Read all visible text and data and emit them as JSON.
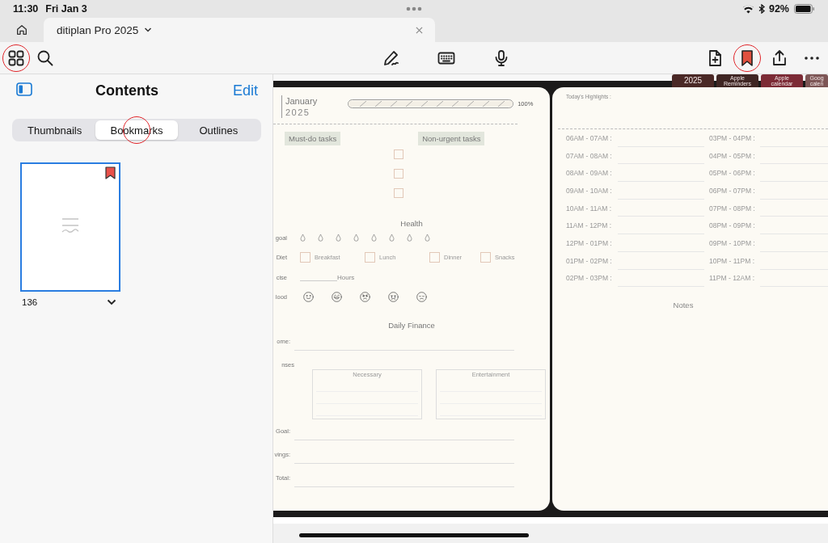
{
  "status_bar": {
    "time": "11:30",
    "date": "Fri Jan 3",
    "battery": "92%"
  },
  "tab_bar": {
    "tab": {
      "title": "ditiplan Pro 2025"
    }
  },
  "toolbar": {
    "left": [
      {
        "kind": "grid",
        "circled": true
      },
      {
        "kind": "search",
        "circled": false
      }
    ],
    "center": [
      {
        "kind": "pen",
        "circled": false
      },
      {
        "kind": "keyboard",
        "circled": false
      },
      {
        "kind": "mic",
        "circled": false
      }
    ],
    "right": [
      {
        "kind": "add-page",
        "circled": false
      },
      {
        "kind": "bookmark",
        "circled": true
      },
      {
        "kind": "share",
        "circled": false
      },
      {
        "kind": "more",
        "circled": false
      }
    ]
  },
  "sidebar": {
    "title": "Contents",
    "edit": "Edit",
    "segments": [
      {
        "label": "Thumbnails",
        "selected": false,
        "circled": false
      },
      {
        "label": "Bookmarks",
        "selected": true,
        "circled": true
      },
      {
        "label": "Outlines",
        "selected": false,
        "circled": false
      }
    ],
    "bookmarks": [
      {
        "page": "136",
        "selected": true
      }
    ]
  },
  "planner": {
    "section_tabs": [
      {
        "label": "2025",
        "color": "#4a2826"
      },
      {
        "label": "Apple Reminders",
        "color": "#3f2624"
      },
      {
        "label": "Apple calendar",
        "color": "#7c2b36"
      },
      {
        "label": "Goog calen",
        "color": "#7d5656"
      }
    ],
    "left_page": {
      "month": "January",
      "year": "2025",
      "progress": {
        "level": 1,
        "reading": "100%"
      },
      "task_headers": [
        "Must-do tasks",
        "Non-urgent tasks"
      ],
      "task_checkboxes": [
        {
          "checked": false
        },
        {
          "checked": false
        },
        {
          "checked": false
        }
      ],
      "health": {
        "title": "Health",
        "rows": [
          {
            "kind": "drops",
            "label": "goal",
            "drops": [
              {
                "filled": false
              },
              {
                "filled": false
              },
              {
                "filled": false
              },
              {
                "filled": false
              },
              {
                "filled": false
              },
              {
                "filled": false
              },
              {
                "filled": false
              },
              {
                "filled": false
              }
            ]
          },
          {
            "kind": "meals",
            "label": "Diet",
            "meals": [
              {
                "label": "Breakfast",
                "checked": false
              },
              {
                "label": "Lunch",
                "checked": false
              },
              {
                "label": "Dinner",
                "checked": false
              },
              {
                "label": "Snacks",
                "checked": false
              }
            ]
          },
          {
            "kind": "hours",
            "label": "cise",
            "unit": "Hours"
          },
          {
            "kind": "moods",
            "label": "lood",
            "moods": [
              {
                "kind": "smile"
              },
              {
                "kind": "grin"
              },
              {
                "kind": "worried"
              },
              {
                "kind": "crying"
              },
              {
                "kind": "sad"
              }
            ]
          }
        ]
      },
      "finance": {
        "title": "Daily Finance",
        "rows": [
          {
            "kind": "line",
            "label": "ome:"
          },
          {
            "kind": "boxes",
            "label": "nses",
            "boxes": [
              "Necessary",
              "Entertainment"
            ]
          },
          {
            "kind": "line",
            "label": "Goal:"
          },
          {
            "kind": "line",
            "label": "vings:"
          },
          {
            "kind": "line",
            "label": "Total:"
          }
        ]
      }
    },
    "right_page": {
      "highlights": "Today's Highlights :",
      "hours_left": [
        "06AM - 07AM :",
        "07AM - 08AM :",
        "08AM - 09AM :",
        "09AM - 10AM :",
        "10AM - 11AM :",
        "11AM - 12PM :",
        "12PM - 01PM :",
        "01PM - 02PM :",
        "02PM - 03PM :"
      ],
      "hours_right": [
        "03PM - 04PM :",
        "04PM - 05PM :",
        "05PM - 06PM :",
        "06PM - 07PM :",
        "07PM - 08PM :",
        "08PM - 09PM :",
        "09PM - 10PM :",
        "10PM - 11PM :",
        "11PM - 12AM :"
      ],
      "notes": "Notes"
    }
  }
}
